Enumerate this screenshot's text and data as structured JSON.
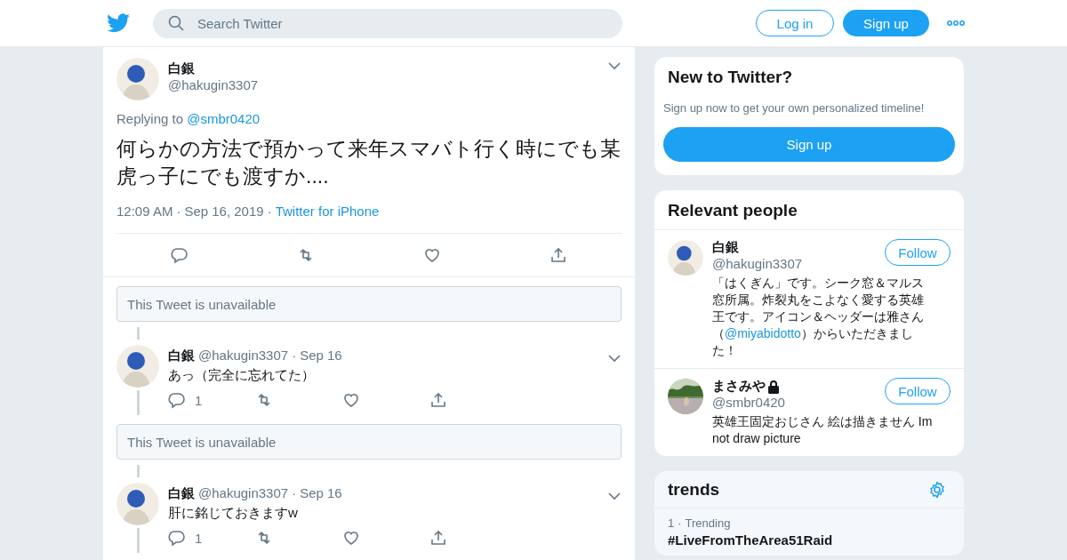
{
  "header": {
    "search": {
      "placeholder": "Search Twitter"
    },
    "login": "Log in",
    "signup": "Sign up"
  },
  "tweet": {
    "name": "白銀",
    "handle": "@hakugin3307",
    "replying_label": "Replying to",
    "replying_to": "@smbr0420",
    "text": "何らかの方法で預かって来年スマバト行く時にでも某虎っ子にでも渡すか....",
    "time": "12:09 AM",
    "sep1": "·",
    "date": "Sep 16, 2019",
    "sep2": "·",
    "source": "Twitter for iPhone"
  },
  "thread": [
    {
      "kind": "unavailable",
      "text": "This Tweet is unavailable"
    },
    {
      "kind": "reply",
      "name": "白銀",
      "handle": "@hakugin3307",
      "sep": "·",
      "date": "Sep 16",
      "text": "あっ（完全に忘れてた）",
      "replies": "1"
    },
    {
      "kind": "unavailable",
      "text": "This Tweet is unavailable"
    },
    {
      "kind": "reply",
      "name": "白銀",
      "handle": "@hakugin3307",
      "sep": "·",
      "date": "Sep 16",
      "text": "肝に銘じておきますw",
      "replies": "1"
    }
  ],
  "new_to_twitter": {
    "title": "New to Twitter?",
    "subtitle": "Sign up now to get your own personalized timeline!",
    "button": "Sign up"
  },
  "relevant_people": {
    "title": "Relevant people",
    "people": [
      {
        "name": "白銀",
        "locked": false,
        "handle": "@hakugin3307",
        "button": "Follow",
        "bio_before": "「はくぎん」です。シーク窓＆マルス窓所属。炸裂丸をこよなく愛する英雄王です。アイコン＆ヘッダーは雅さん（",
        "bio_link": "@miyabidotto",
        "bio_after": "）からいただきました！"
      },
      {
        "name": "まさみや",
        "locked": true,
        "handle": "@smbr0420",
        "button": "Follow",
        "bio_before": "英雄王固定おじさん 絵は描きません Im not draw picture"
      }
    ]
  },
  "trends": {
    "title": "trends",
    "items": [
      {
        "rank": "1",
        "sep": "·",
        "label": "Trending",
        "name": "#LiveFromTheArea51Raid"
      }
    ]
  }
}
